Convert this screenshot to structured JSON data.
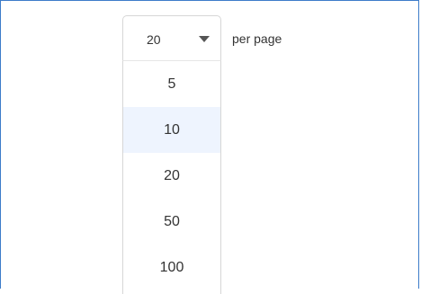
{
  "page_size": {
    "selected_value": "20",
    "suffix_label": "per page",
    "options": [
      {
        "label": "5"
      },
      {
        "label": "10",
        "highlighted": true
      },
      {
        "label": "20"
      },
      {
        "label": "50"
      },
      {
        "label": "100"
      }
    ]
  },
  "colors": {
    "frame_border": "#3d7cc9",
    "highlight_bg": "#eef4fe",
    "border": "#d6d6d6",
    "text": "#333333"
  },
  "icons": {
    "caret": "caret-down-icon"
  }
}
